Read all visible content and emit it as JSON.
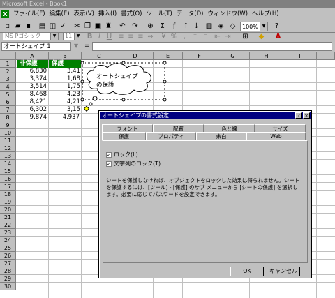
{
  "window": {
    "title": "Microsoft Excel - Book1"
  },
  "menu": [
    "ファイル(F)",
    "編集(E)",
    "表示(V)",
    "挿入(I)",
    "書式(O)",
    "ツール(T)",
    "データ(D)",
    "ウィンドウ(W)",
    "ヘルプ(H)"
  ],
  "toolbar": {
    "zoom": "100%",
    "font": "MS Pゴシック",
    "font_size": "11"
  },
  "formula_bar": {
    "name_box": "オートシェイプ 1",
    "equals": "="
  },
  "columns": [
    "A",
    "B",
    "C",
    "D",
    "E",
    "F",
    "G",
    "H",
    "I"
  ],
  "rows": [
    "1",
    "2",
    "3",
    "4",
    "5",
    "6",
    "7",
    "8",
    "9",
    "10",
    "11",
    "12",
    "13",
    "14",
    "15",
    "16",
    "17",
    "18",
    "19",
    "20",
    "21",
    "22",
    "23",
    "24",
    "25",
    "26",
    "27",
    "28",
    "29",
    "30"
  ],
  "sheet": {
    "a_header": "非保護",
    "b_header": "保護",
    "a_values": [
      "6,830",
      "3,374",
      "3,514",
      "8,468",
      "8,421",
      "6,302",
      "9,874"
    ],
    "b_values": [
      "3,41",
      "1,68",
      "1,75",
      "4,23",
      "4,21",
      "3,15",
      "4,937"
    ]
  },
  "callout": {
    "text": "オートシェイプの保護"
  },
  "dialog": {
    "title": "オートシェイプの書式設定",
    "help": "?",
    "close": "×",
    "tabs_back": [
      "フォント",
      "配置",
      "色と線",
      "サイズ"
    ],
    "tabs_front": [
      "保護",
      "プロパティ",
      "余白",
      "Web"
    ],
    "checkbox1": "ロック(L)",
    "checkbox2": "文字列のロック(T)",
    "note": "シートを保護しなければ、オブジェクトをロックした効果は得られません。シートを保護するには、[ツール] - [保護] のサブ メニューから [シートの保護] を選択します。必要に応じてパスワードを設定できます。",
    "ok": "OK",
    "cancel": "キャンセル"
  }
}
